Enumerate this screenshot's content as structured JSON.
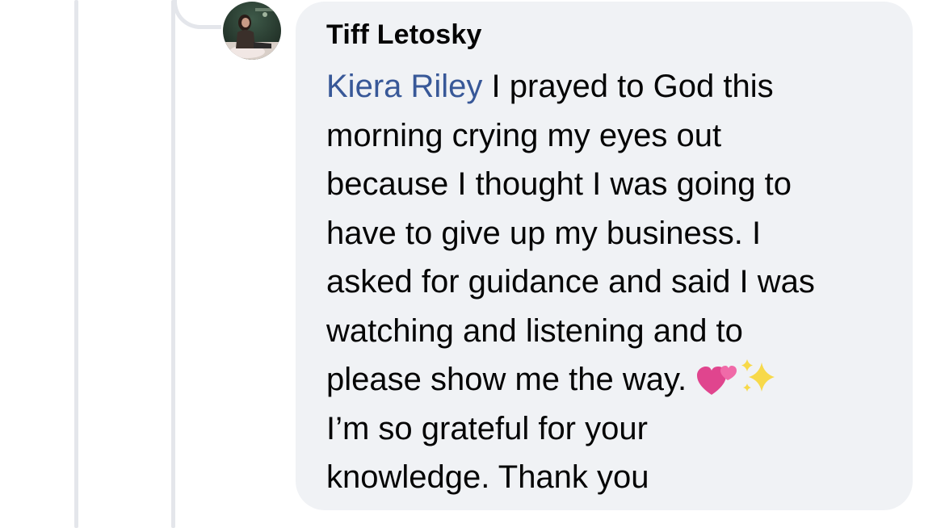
{
  "comment": {
    "author_name": "Tiff Letosky",
    "mention": "Kiera Riley",
    "lines": [
      " I prayed to God this",
      "morning crying my eyes out",
      "because I thought I was going to",
      "have to give up my business. I",
      "asked for guidance and said I was",
      "watching and listening and to",
      "please show me the way. ",
      "I’m so grateful for your",
      "knowledge. Thank you"
    ],
    "emojis": [
      "two-hearts",
      "sparkles"
    ]
  },
  "colors": {
    "bubble_bg": "#f0f2f5",
    "text": "#050505",
    "mention": "#385898",
    "thread_line": "#e4e6eb"
  }
}
